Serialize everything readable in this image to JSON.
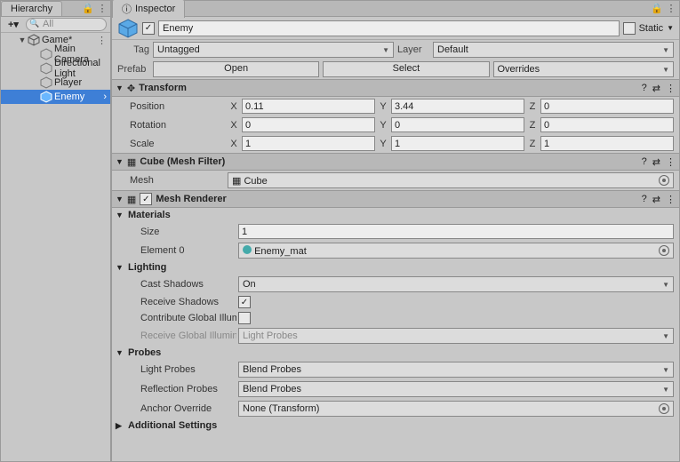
{
  "hierarchy": {
    "tab": "Hierarchy",
    "search_placeholder": "All",
    "root": "Game*",
    "items": [
      "Main Camera",
      "Directional Light",
      "Player",
      "Enemy"
    ],
    "selected": "Enemy"
  },
  "inspector": {
    "tab": "Inspector",
    "name": "Enemy",
    "static_label": "Static",
    "tag_label": "Tag",
    "tag_value": "Untagged",
    "layer_label": "Layer",
    "layer_value": "Default",
    "prefab_label": "Prefab",
    "open_btn": "Open",
    "select_btn": "Select",
    "overrides_btn": "Overrides"
  },
  "transform": {
    "title": "Transform",
    "position_label": "Position",
    "rotation_label": "Rotation",
    "scale_label": "Scale",
    "pos": {
      "x": "0.11",
      "y": "3.44",
      "z": "0"
    },
    "rot": {
      "x": "0",
      "y": "0",
      "z": "0"
    },
    "scale": {
      "x": "1",
      "y": "1",
      "z": "1"
    }
  },
  "meshfilter": {
    "title": "Cube (Mesh Filter)",
    "mesh_label": "Mesh",
    "mesh_value": "Cube"
  },
  "renderer": {
    "title": "Mesh Renderer",
    "materials": "Materials",
    "size_label": "Size",
    "size_value": "1",
    "element0_label": "Element 0",
    "element0_value": "Enemy_mat",
    "lighting": "Lighting",
    "cast_label": "Cast Shadows",
    "cast_value": "On",
    "receive_label": "Receive Shadows",
    "contribute_label": "Contribute Global Illumination",
    "receive_gi_label": "Receive Global Illumination",
    "receive_gi_value": "Light Probes",
    "probes": "Probes",
    "light_probes_label": "Light Probes",
    "light_probes_value": "Blend Probes",
    "refl_label": "Reflection Probes",
    "refl_value": "Blend Probes",
    "anchor_label": "Anchor Override",
    "anchor_value": "None (Transform)",
    "additional": "Additional Settings"
  }
}
